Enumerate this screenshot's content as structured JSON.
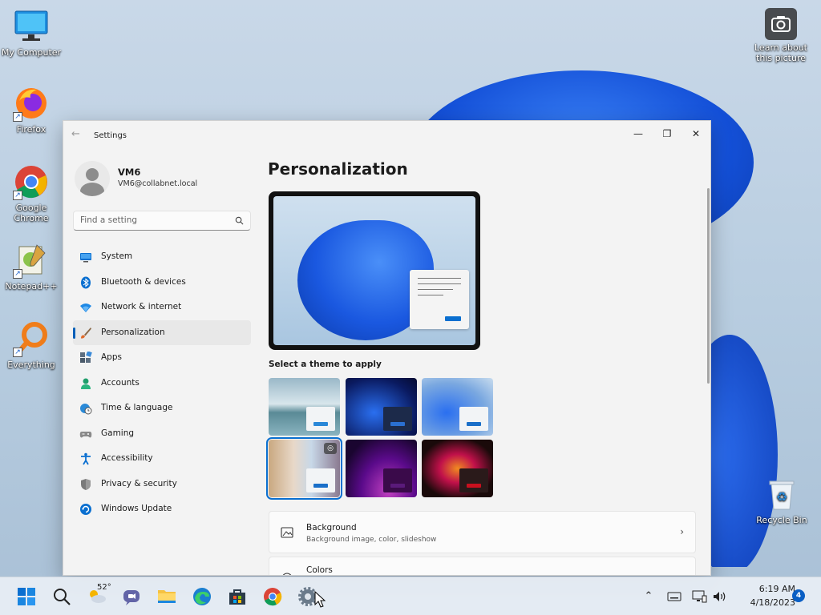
{
  "desktop": {
    "icons": [
      {
        "label": "My Computer",
        "icon": "monitor-icon"
      },
      {
        "label": "Firefox",
        "icon": "firefox-icon"
      },
      {
        "label": "Google Chrome",
        "icon": "chrome-icon"
      },
      {
        "label": "Notepad++",
        "icon": "notepadpp-icon"
      },
      {
        "label": "Everything",
        "icon": "everything-search-icon"
      },
      {
        "label": "Recycle Bin",
        "icon": "recycle-bin-icon"
      }
    ],
    "spotlight": {
      "label": "Learn about this picture",
      "icon": "camera-icon"
    }
  },
  "window": {
    "title": "Settings",
    "controls": {
      "minimize": "—",
      "maximize": "❐",
      "close": "✕"
    }
  },
  "sidebar": {
    "user": {
      "name": "VM6",
      "email": "VM6@collabnet.local"
    },
    "search_placeholder": "Find a setting",
    "items": [
      {
        "label": "System",
        "icon": "system-monitor-icon",
        "color": "#0a6fd0"
      },
      {
        "label": "Bluetooth & devices",
        "icon": "bluetooth-icon",
        "color": "#0a6fd0"
      },
      {
        "label": "Network & internet",
        "icon": "wifi-icon",
        "color": "#0a6fd0"
      },
      {
        "label": "Personalization",
        "icon": "paintbrush-icon",
        "color": "#d86a30",
        "active": true
      },
      {
        "label": "Apps",
        "icon": "apps-grid-icon",
        "color": "#4a5a6a"
      },
      {
        "label": "Accounts",
        "icon": "account-icon",
        "color": "#1f9e6b"
      },
      {
        "label": "Time & language",
        "icon": "globe-clock-icon",
        "color": "#0a6fd0"
      },
      {
        "label": "Gaming",
        "icon": "gamepad-icon",
        "color": "#6b6b6b"
      },
      {
        "label": "Accessibility",
        "icon": "accessibility-icon",
        "color": "#0a6fd0"
      },
      {
        "label": "Privacy & security",
        "icon": "shield-icon",
        "color": "#6b6b6b"
      },
      {
        "label": "Windows Update",
        "icon": "update-icon",
        "color": "#0a6fd0"
      }
    ]
  },
  "main": {
    "title": "Personalization",
    "themes_label": "Select a theme to apply",
    "themes": [
      {
        "name": "theme-lake",
        "accent": "#2a88d8"
      },
      {
        "name": "theme-dark-bloom",
        "accent": "#2a6fd0"
      },
      {
        "name": "theme-light-bloom",
        "accent": "#1a6fc9"
      },
      {
        "name": "theme-spotlight",
        "accent": "#1a6fc9",
        "selected": true
      },
      {
        "name": "theme-glow",
        "accent": "#5a1a7a"
      },
      {
        "name": "theme-flower",
        "accent": "#c8101e"
      }
    ],
    "settings": [
      {
        "title": "Background",
        "subtitle": "Background image, color, slideshow",
        "icon": "picture-icon"
      },
      {
        "title": "Colors",
        "subtitle": "",
        "icon": "palette-icon"
      }
    ]
  },
  "taskbar": {
    "weather_temp": "52°",
    "apps": [
      "start-icon",
      "search-icon",
      "weather-icon",
      "teams-chat-icon",
      "file-explorer-icon",
      "edge-icon",
      "store-icon",
      "chrome-icon",
      "settings-gear-icon"
    ],
    "clock": {
      "time": "6:19 AM",
      "date": "4/18/2023"
    },
    "notifications": "4"
  }
}
